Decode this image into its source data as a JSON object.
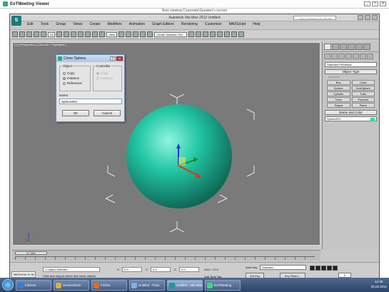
{
  "viewer": {
    "title": "EoTMeeting Viewer",
    "session": "Now viewing Corporate\\Speaker's screen"
  },
  "app": {
    "logo": "S",
    "title": "Autodesk 3ds Max 2012      Untitled",
    "search_placeholder": "Type a keyword or phrase",
    "menu": [
      "Edit",
      "Tools",
      "Group",
      "Views",
      "Create",
      "Modifiers",
      "Animation",
      "Graph Editors",
      "Rendering",
      "Customize",
      "MAXScript",
      "Help"
    ],
    "toolbar_selects": [
      "All",
      "View"
    ],
    "toolbar_create_sel": "Create Selection Set"
  },
  "viewport": {
    "label": "[+] [ Perspective ] [ Smooth + Highlights ]"
  },
  "command_panel": {
    "dropdown": "Standard Primitives",
    "object_type_title": "Object Type",
    "autogrid": "AutoGrid",
    "primitives": [
      "Box",
      "Cone",
      "Sphere",
      "GeoSphere",
      "Cylinder",
      "Tube",
      "Torus",
      "Pyramid",
      "Teapot",
      "Plane"
    ],
    "name_color_title": "Name and Color",
    "name_value": "Sphere001",
    "object_color": "#22ddaa"
  },
  "dialog": {
    "title": "Clone Options",
    "help_btn": "?",
    "close_btn": "x",
    "object_group": "Object",
    "object_options": [
      {
        "label": "Copy",
        "on": false
      },
      {
        "label": "Instance",
        "on": true
      },
      {
        "label": "Reference",
        "on": false
      }
    ],
    "controller_group": "Controller",
    "controller_options": [
      {
        "label": "Copy",
        "on": true
      },
      {
        "label": "Instance",
        "on": false
      }
    ],
    "name_label": "Name:",
    "name_value": "Sphere002",
    "ok": "OK",
    "cancel": "Cancel"
  },
  "timeline": {
    "frame_label": "0 / 100"
  },
  "status": {
    "maxscript": "Welcome to M",
    "selection": "1 Object Selected",
    "prompt": "Click and drag to select and move objects",
    "x_label": "X:",
    "x": "0.0",
    "y_label": "Y:",
    "y": "0.0",
    "z_label": "Z:",
    "z": "0.0",
    "grid": "Grid = 10.0",
    "add_time_tag": "Add Time Tag",
    "auto_key": "Auto Key",
    "set_key": "Set Key",
    "selected": "Selected",
    "key_filters": "Key Filters...",
    "frame": "0"
  },
  "taskbar": {
    "items": [
      {
        "label": "Internet",
        "color": "#3a7bd5"
      },
      {
        "label": "Screenshots",
        "color": "#d8b03a"
      },
      {
        "label": "Firefox",
        "color": "#e86a1a"
      },
      {
        "label": "Untitled - Paint",
        "color": "#7fb0e0"
      },
      {
        "label": "Untitled - 3ds Max",
        "color": "#1a9a9a"
      },
      {
        "label": "EoTMeeting",
        "color": "#3d7"
      }
    ],
    "time": "12:36",
    "date": "25.02.2011"
  }
}
